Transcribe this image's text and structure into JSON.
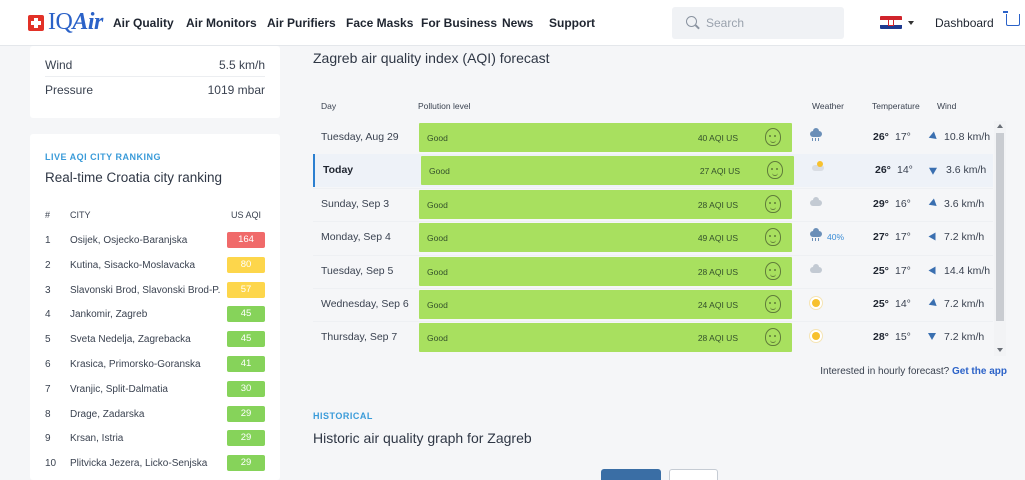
{
  "nav": {
    "logo_iq": "IQ",
    "logo_air": "Air",
    "links": [
      "Air Quality",
      "Air Monitors",
      "Air Purifiers",
      "Face Masks",
      "For Business",
      "News",
      "Support"
    ],
    "search_placeholder": "Search",
    "dashboard": "Dashboard"
  },
  "weather_panel": {
    "rows": [
      {
        "label": "Wind",
        "value": "5.5 km/h"
      },
      {
        "label": "Pressure",
        "value": "1019 mbar"
      }
    ]
  },
  "ranking": {
    "kicker": "LIVE AQI CITY RANKING",
    "title": "Real-time Croatia city ranking",
    "col_num": "#",
    "col_city": "CITY",
    "col_aqi": "US AQI",
    "rows": [
      {
        "num": "1",
        "city": "Osijek, Osjecko-Baranjska",
        "aqi": "164",
        "color": "#f06a6a"
      },
      {
        "num": "2",
        "city": "Kutina, Sisacko-Moslavacka",
        "aqi": "80",
        "color": "#fdd64b"
      },
      {
        "num": "3",
        "city": "Slavonski Brod, Slavonski Brod-P...",
        "aqi": "57",
        "color": "#fdd64b"
      },
      {
        "num": "4",
        "city": "Jankomir, Zagreb",
        "aqi": "45",
        "color": "#86d35a"
      },
      {
        "num": "5",
        "city": "Sveta Nedelja, Zagrebacka",
        "aqi": "45",
        "color": "#86d35a"
      },
      {
        "num": "6",
        "city": "Krasica, Primorsko-Goranska",
        "aqi": "41",
        "color": "#86d35a"
      },
      {
        "num": "7",
        "city": "Vranjic, Split-Dalmatia",
        "aqi": "30",
        "color": "#86d35a"
      },
      {
        "num": "8",
        "city": "Drage, Zadarska",
        "aqi": "29",
        "color": "#86d35a"
      },
      {
        "num": "9",
        "city": "Krsan, Istria",
        "aqi": "29",
        "color": "#86d35a"
      },
      {
        "num": "10",
        "city": "Plitvicka Jezera, Licko-Senjska",
        "aqi": "29",
        "color": "#86d35a"
      }
    ]
  },
  "forecast": {
    "title": "Zagreb air quality index (AQI) forecast",
    "headers": {
      "day": "Day",
      "pollution": "Pollution level",
      "weather": "Weather",
      "temperature": "Temperature",
      "wind": "Wind"
    },
    "rows": [
      {
        "day": "Tuesday, Aug 29",
        "level": "Good",
        "aqi": "40 AQI US",
        "weather": "rain",
        "precip": "",
        "hi": "26°",
        "lo": "17°",
        "wind": "10.8 km/h",
        "today": false
      },
      {
        "day": "Today",
        "level": "Good",
        "aqi": "27 AQI US",
        "weather": "partly",
        "precip": "",
        "hi": "26°",
        "lo": "14°",
        "wind": "3.6 km/h",
        "today": true
      },
      {
        "day": "Sunday, Sep 3",
        "level": "Good",
        "aqi": "28 AQI US",
        "weather": "cloud",
        "precip": "",
        "hi": "29°",
        "lo": "16°",
        "wind": "3.6 km/h",
        "today": false
      },
      {
        "day": "Monday, Sep 4",
        "level": "Good",
        "aqi": "49 AQI US",
        "weather": "rain",
        "precip": "40%",
        "hi": "27°",
        "lo": "17°",
        "wind": "7.2 km/h",
        "today": false
      },
      {
        "day": "Tuesday, Sep 5",
        "level": "Good",
        "aqi": "28 AQI US",
        "weather": "cloud",
        "precip": "",
        "hi": "25°",
        "lo": "17°",
        "wind": "14.4 km/h",
        "today": false
      },
      {
        "day": "Wednesday, Sep 6",
        "level": "Good",
        "aqi": "24 AQI US",
        "weather": "sun",
        "precip": "",
        "hi": "25°",
        "lo": "14°",
        "wind": "7.2 km/h",
        "today": false
      },
      {
        "day": "Thursday, Sep 7",
        "level": "Good",
        "aqi": "28 AQI US",
        "weather": "sun",
        "precip": "",
        "hi": "28°",
        "lo": "15°",
        "wind": "7.2 km/h",
        "today": false
      }
    ],
    "hourly_text": "Interested in hourly forecast?",
    "hourly_link": "Get the app"
  },
  "historical": {
    "kicker": "HISTORICAL",
    "title": "Historic air quality graph for Zagreb"
  },
  "colors": {
    "good": "#a8e05f",
    "accent": "#2b62c8",
    "kicker": "#3a9bd9"
  }
}
